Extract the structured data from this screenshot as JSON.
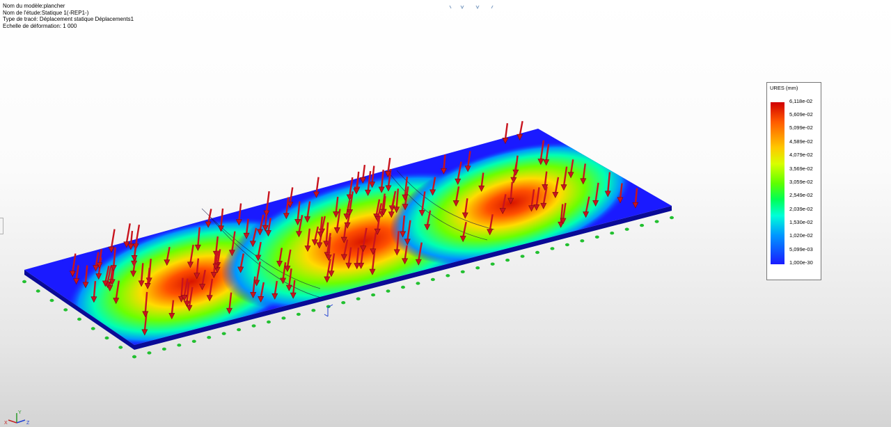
{
  "study_info": {
    "model_name": "Nom du modèle:plancher",
    "study_name": "Nom de l'étude:Statique 1(-REP1-)",
    "plot_type": "Type de tracé: Déplacement statique Déplacements1",
    "deformation_scale": "Echelle de déformation: 1 000"
  },
  "legend": {
    "title": "URES (mm)",
    "labels": [
      "6,118e-02",
      "5,609e-02",
      "5,099e-02",
      "4,589e-02",
      "4,079e-02",
      "3,569e-02",
      "3,059e-02",
      "2,549e-02",
      "2,039e-02",
      "1,530e-02",
      "1,020e-02",
      "5,099e-03",
      "1,000e-30"
    ],
    "colors": [
      "#d00000",
      "#ff5a00",
      "#ffc800",
      "#d8ff00",
      "#5fff00",
      "#00ff55",
      "#00ffd8",
      "#0098ff",
      "#1a1aff"
    ]
  },
  "model_view": {
    "plate_color": "#1a1aff",
    "plate_edge_color": "#0a0a96",
    "load_arrow_color": "#c8141e",
    "fixture_color": "#22c030",
    "triad_axes": [
      "X",
      "Y",
      "Z"
    ]
  }
}
